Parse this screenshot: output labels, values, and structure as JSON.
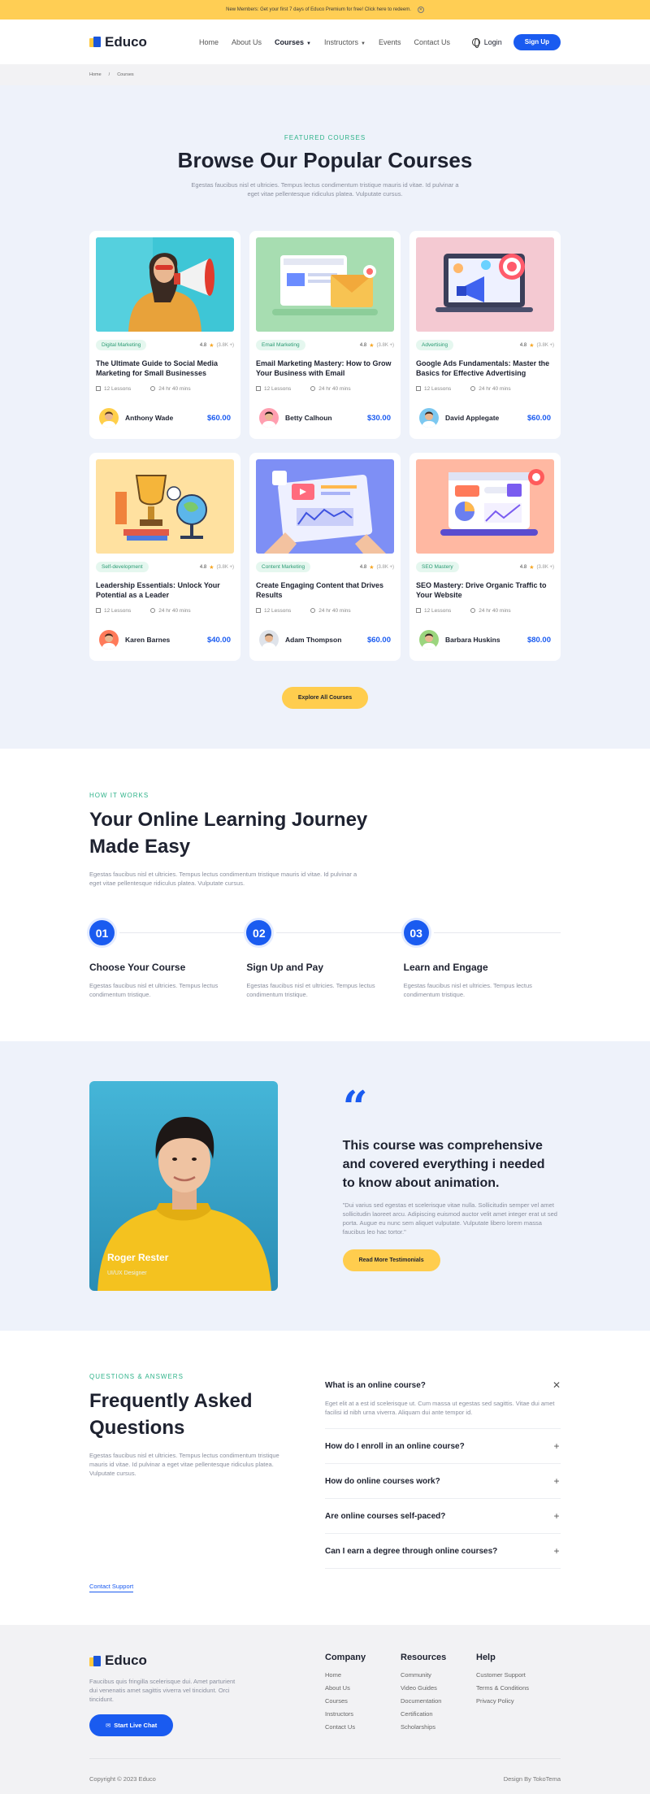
{
  "topbar": {
    "text": "New Members: Get your first 7 days of Educo Premium for free! Click here to redeem.",
    "close_icon": "close-icon"
  },
  "header": {
    "logo_text": "Educo",
    "nav": [
      {
        "label": "Home"
      },
      {
        "label": "About Us"
      },
      {
        "label": "Courses",
        "caret": true,
        "active": true
      },
      {
        "label": "Instructors",
        "caret": true
      },
      {
        "label": "Events"
      },
      {
        "label": "Contact Us"
      }
    ],
    "login_label": "Login",
    "signup_label": "Sign Up"
  },
  "breadcrumb": {
    "home": "Home",
    "sep": "/",
    "current": "Courses"
  },
  "courses_section": {
    "eyebrow": "FEATURED COURSES",
    "title": "Browse Our Popular Courses",
    "subtitle": "Egestas faucibus nisl et ultricies. Tempus lectus condimentum tristique mauris id vitae. Id pulvinar a eget vitae pellentesque ridiculus platea. Vulputate cursus.",
    "explore_label": "Explore All Courses",
    "cards": [
      {
        "tag": "Digital Marketing",
        "rating": "4.8",
        "count": "(3.8K +)",
        "title": "The Ultimate Guide to Social Media Marketing for Small Businesses",
        "lessons": "12 Lessons",
        "duration": "24 hr 40 mins",
        "author": "Anthony Wade",
        "price": "$60.00"
      },
      {
        "tag": "Email Marketing",
        "rating": "4.8",
        "count": "(3.8K +)",
        "title": "Email Marketing Mastery: How to Grow Your Business with Email",
        "lessons": "12 Lessons",
        "duration": "24 hr 40 mins",
        "author": "Betty Calhoun",
        "price": "$30.00"
      },
      {
        "tag": "Advertising",
        "rating": "4.8",
        "count": "(3.8K +)",
        "title": "Google Ads Fundamentals: Master the Basics for Effective Advertising",
        "lessons": "12 Lessons",
        "duration": "24 hr 40 mins",
        "author": "David Applegate",
        "price": "$60.00"
      },
      {
        "tag": "Self-development",
        "rating": "4.8",
        "count": "(3.8K +)",
        "title": "Leadership Essentials: Unlock Your Potential as a Leader",
        "lessons": "12 Lessons",
        "duration": "24 hr 40 mins",
        "author": "Karen Barnes",
        "price": "$40.00"
      },
      {
        "tag": "Content Marketing",
        "rating": "4.8",
        "count": "(3.8K +)",
        "title": "Create Engaging Content that Drives Results",
        "lessons": "12 Lessons",
        "duration": "24 hr 40 mins",
        "author": "Adam Thompson",
        "price": "$60.00"
      },
      {
        "tag": "SEO Mastery",
        "rating": "4.8",
        "count": "(3.8K +)",
        "title": "SEO Mastery: Drive Organic Traffic to Your Website",
        "lessons": "12 Lessons",
        "duration": "24 hr 40 mins",
        "author": "Barbara Huskins",
        "price": "$80.00"
      }
    ]
  },
  "how_section": {
    "eyebrow": "HOW IT WORKS",
    "title": "Your Online Learning Journey Made Easy",
    "subtitle": "Egestas faucibus nisl et ultricies. Tempus lectus condimentum tristique mauris id vitae. Id pulvinar a eget vitae pellentesque ridiculus platea. Vulputate cursus.",
    "steps": [
      {
        "num": "01",
        "title": "Choose Your Course",
        "text": "Egestas faucibus nisl et ultricies. Tempus lectus condimentum tristique."
      },
      {
        "num": "02",
        "title": "Sign Up and Pay",
        "text": "Egestas faucibus nisl et ultricies. Tempus lectus condimentum tristique."
      },
      {
        "num": "03",
        "title": "Learn and Engage",
        "text": "Egestas faucibus nisl et ultricies. Tempus lectus condimentum tristique."
      }
    ]
  },
  "testimonial": {
    "name": "Roger Rester",
    "role": "UI/UX Designer",
    "quote_mark": "“",
    "headline": "This course was comprehensive and covered everything i needed to know about animation.",
    "text": "\"Dui varius sed egestas et scelerisque vitae nulla. Sollicitudin semper vel amet sollicitudin laoreet arcu. Adipiscing euismod auctor velit amet integer erat ut sed porta. Augue eu nunc sem aliquet vulputate. Vulputate libero lorem massa faucibus leo hac tortor.\"",
    "button_label": "Read More Testimonials"
  },
  "faq": {
    "eyebrow": "QUESTIONS & ANSWERS",
    "title": "Frequently Asked Questions",
    "subtitle": "Egestas faucibus nisl et ultricies. Tempus lectus condimentum tristique mauris id vitae. Id pulvinar a eget vitae pellentesque ridiculus platea. Vulputate cursus.",
    "contact_label": "Contact Support",
    "items": [
      {
        "q": "What is an online course?",
        "a": "Eget elit at a est id scelerisque ut. Cum massa ut egestas sed sagittis. Vitae dui amet facilisi id nibh urna viverra. Aliquam dui ante tempor id.",
        "open": true,
        "toggle": "✕"
      },
      {
        "q": "How do I enroll in an online course?",
        "a": "",
        "open": false,
        "toggle": "+"
      },
      {
        "q": "How do online courses work?",
        "a": "",
        "open": false,
        "toggle": "+"
      },
      {
        "q": "Are online courses self-paced?",
        "a": "",
        "open": false,
        "toggle": "+"
      },
      {
        "q": "Can I earn a degree through online courses?",
        "a": "",
        "open": false,
        "toggle": "+"
      }
    ]
  },
  "footer": {
    "logo_text": "Educo",
    "text": "Faucibus quis fringilla scelerisque dui. Amet parturient dui venenatis amet sagittis viverra vel tincidunt. Orci tincidunt.",
    "chat_label": "Start Live Chat",
    "columns": [
      {
        "title": "Company",
        "links": [
          "Home",
          "About Us",
          "Courses",
          "Instructors",
          "Contact Us"
        ]
      },
      {
        "title": "Resources",
        "links": [
          "Community",
          "Video Guides",
          "Documentation",
          "Certification",
          "Scholarships"
        ]
      },
      {
        "title": "Help",
        "links": [
          "Customer Support",
          "Terms & Conditions",
          "Privacy Policy"
        ]
      }
    ],
    "copyright": "Copyright © 2023 Educo",
    "credit": "Design By TokoTema"
  },
  "colors": {
    "accent": "#1a5bf0",
    "yellow": "#ffcd4e",
    "green": "#2fb38a",
    "section_bg": "#eef2fa"
  }
}
